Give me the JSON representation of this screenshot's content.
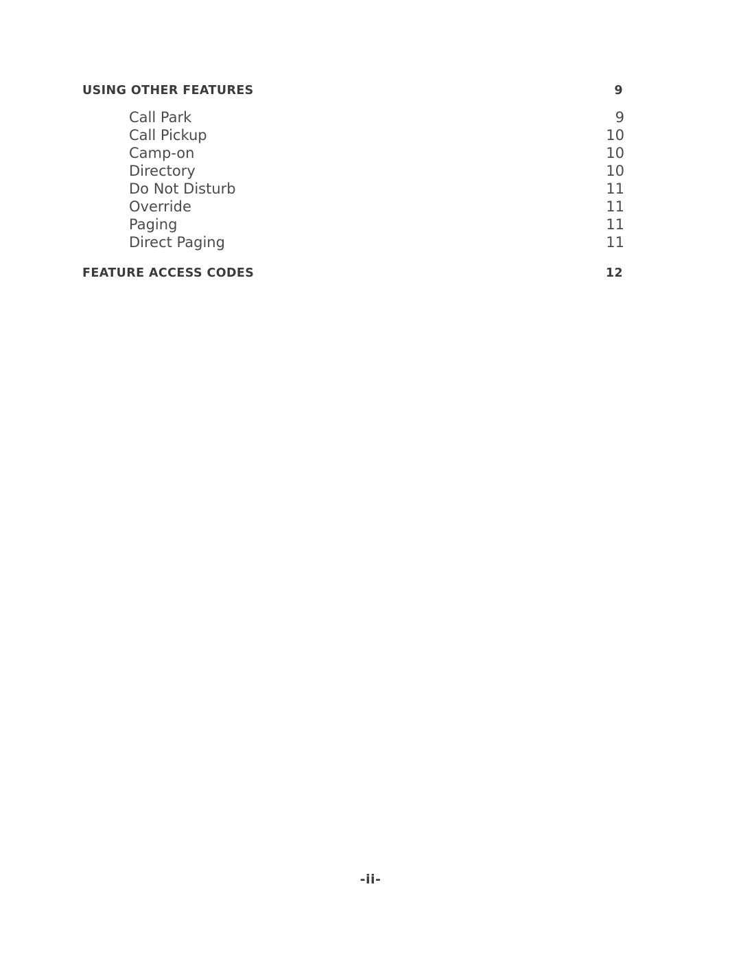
{
  "document": {
    "footer_page_marker": "-ii-",
    "toc": {
      "sections": [
        {
          "title": "USING OTHER FEATURES",
          "page": "9",
          "entries": [
            {
              "label": "Call Park",
              "page": "9"
            },
            {
              "label": "Call Pickup",
              "page": "10"
            },
            {
              "label": "Camp-on",
              "page": "10"
            },
            {
              "label": "Directory",
              "page": "10"
            },
            {
              "label": "Do Not Disturb",
              "page": "11"
            },
            {
              "label": "Override",
              "page": "11"
            },
            {
              "label": "Paging",
              "page": "11"
            },
            {
              "label": "Direct Paging",
              "page": "11"
            }
          ]
        },
        {
          "title": "FEATURE ACCESS CODES",
          "page": "12",
          "entries": []
        }
      ]
    }
  }
}
